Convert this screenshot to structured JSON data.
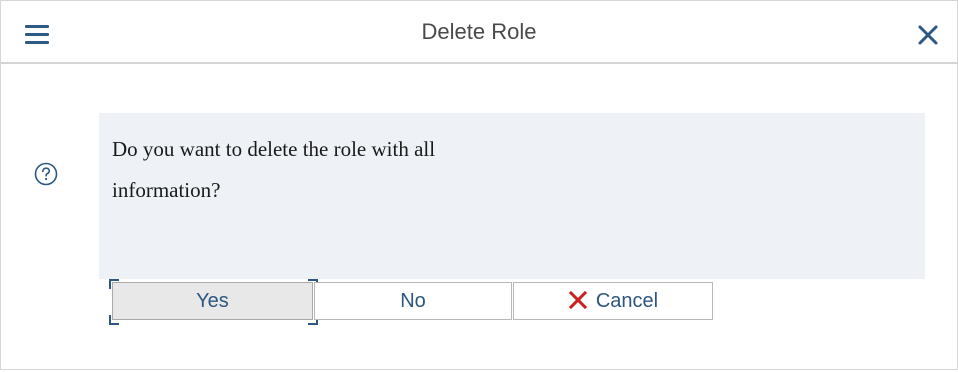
{
  "dialog": {
    "title": "Delete Role",
    "message": "Do you want to delete the role with all information?",
    "icons": {
      "menu": "hamburger-menu-icon",
      "close": "close-icon",
      "help": "question-circle-icon",
      "cancel": "red-x-icon"
    },
    "buttons": {
      "yes": "Yes",
      "no": "No",
      "cancel": "Cancel"
    },
    "focused_button": "yes"
  },
  "colors": {
    "accent": "#2c5782",
    "message_background": "#eef2f6",
    "cancel_icon": "#cc1f1f"
  }
}
